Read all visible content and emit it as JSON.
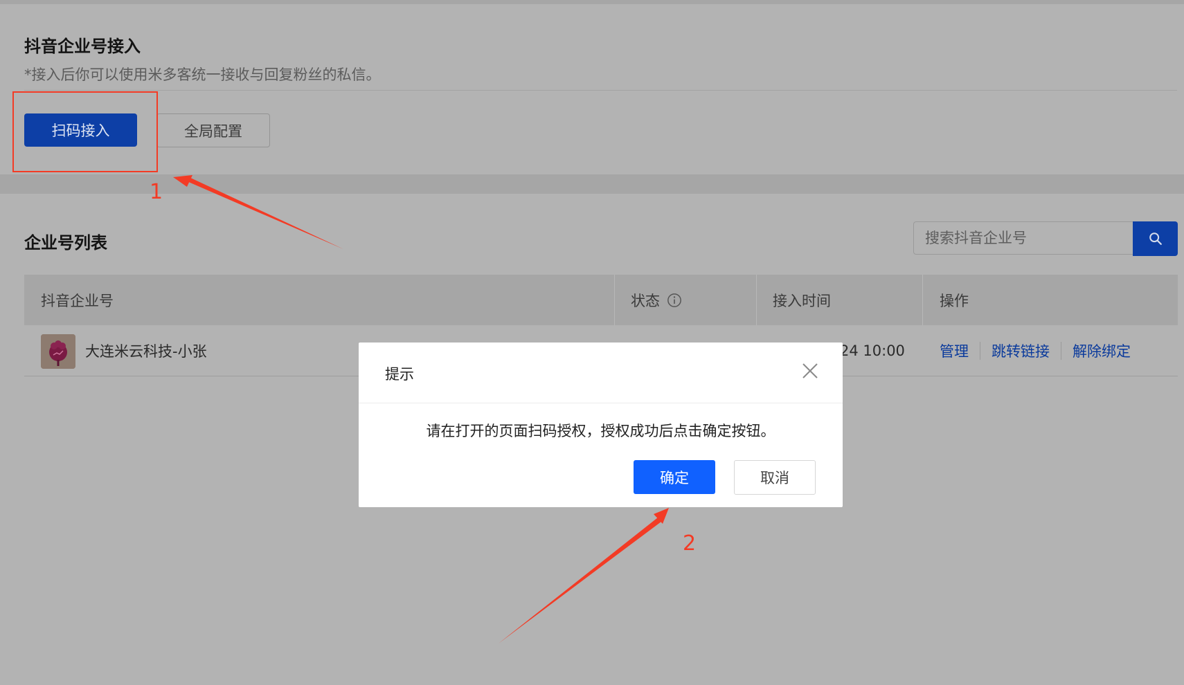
{
  "integration": {
    "title": "抖音企业号接入",
    "description": "*接入后你可以使用米多客统一接收与回复粉丝的私信。",
    "scan_button_label": "扫码接入",
    "global_config_button_label": "全局配置"
  },
  "account_list": {
    "title": "企业号列表",
    "search": {
      "placeholder": "搜索抖音企业号",
      "value": ""
    },
    "columns": {
      "account": "抖音企业号",
      "status": "状态",
      "time": "接入时间",
      "actions": "操作"
    },
    "rows": [
      {
        "name": "大连米云科技-小张",
        "time_visible": "24 10:00",
        "actions": [
          "管理",
          "跳转链接",
          "解除绑定"
        ]
      }
    ]
  },
  "dialog": {
    "title": "提示",
    "message": "请在打开的页面扫码授权，授权成功后点击确定按钮。",
    "confirm_label": "确定",
    "cancel_label": "取消"
  },
  "annotations": {
    "step1": "1",
    "step2": "2"
  },
  "icons": {
    "search": "search-icon",
    "info": "info-circle-icon",
    "close": "close-icon"
  },
  "colors": {
    "primary_dim": "#0d3fa6",
    "primary": "#1061ff",
    "annotation": "#f33b25",
    "link": "#0a3a9c"
  }
}
